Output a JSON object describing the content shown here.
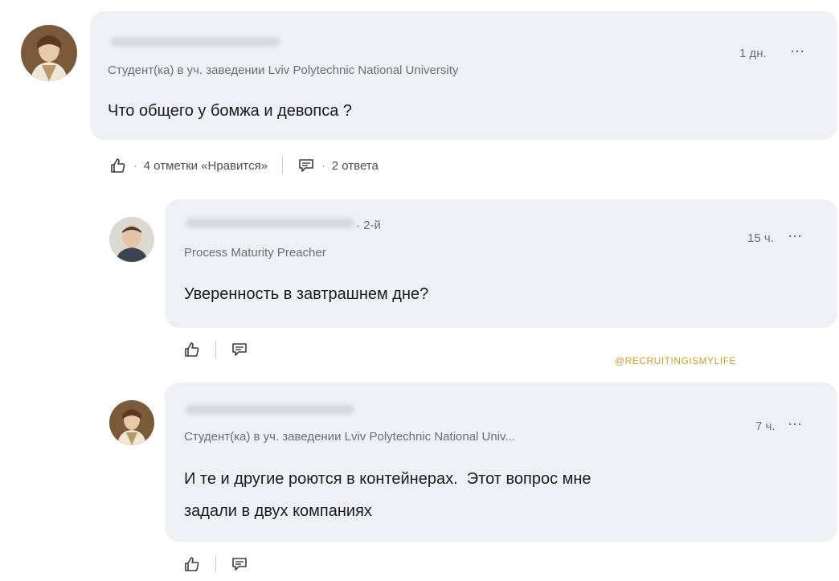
{
  "comments": [
    {
      "headline": "Студент(ка) в уч. заведении Lviv Polytechnic National University",
      "time": "1 дн.",
      "more": "···",
      "text": "Что общего у бомжа и девопса ?",
      "actions": {
        "likes_label": "4 отметки «Нравится»",
        "replies_label": "2 ответа"
      }
    }
  ],
  "replies": [
    {
      "degree": "· 2-й",
      "headline": "Process Maturity Preacher",
      "time": "15 ч.",
      "more": "···",
      "text": "Уверенность в завтрашнем дне?"
    },
    {
      "headline": "Студент(ка) в уч. заведении Lviv Polytechnic National Univ...",
      "time": "7 ч.",
      "more": "···",
      "text_line1": "И те и другие роются в контейнерах.  Этот вопрос мне",
      "text_line2": "задали в двух компаниях"
    }
  ],
  "watermark": "@RECRUITINGISMYLIFE",
  "icons": {
    "like": "thumbs-up-icon",
    "reply": "comment-icon",
    "more": "more-icon"
  },
  "colors": {
    "bubble": "#eef0f3",
    "meta_text": "#6b6e72",
    "watermark": "#c79f33"
  }
}
